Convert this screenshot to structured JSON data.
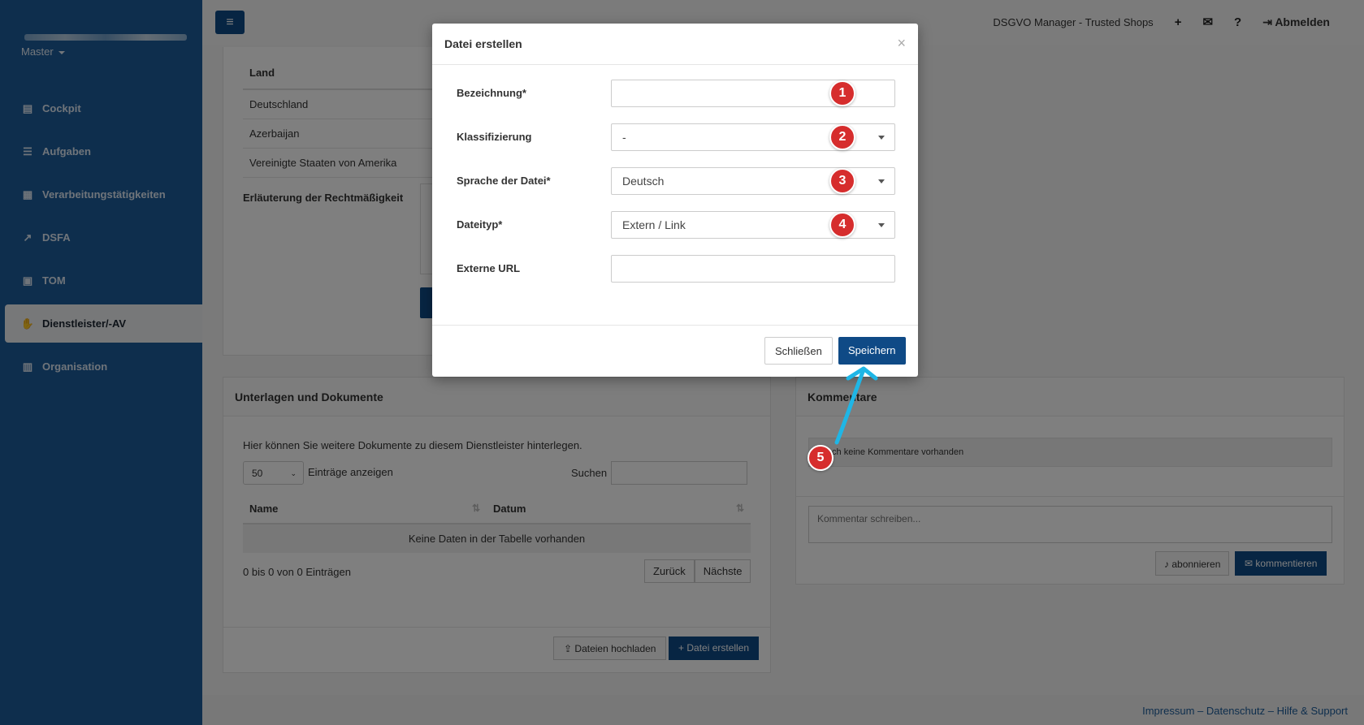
{
  "sidebar": {
    "master_label": "Master",
    "items": [
      {
        "label": "Cockpit",
        "icon": "chart-icon"
      },
      {
        "label": "Aufgaben",
        "icon": "list-icon"
      },
      {
        "label": "Verarbeitungstätigkeiten",
        "icon": "table-icon"
      },
      {
        "label": "DSFA",
        "icon": "line-chart-icon"
      },
      {
        "label": "TOM",
        "icon": "lock-icon"
      },
      {
        "label": "Dienstleister/-AV",
        "icon": "handshake-icon"
      },
      {
        "label": "Organisation",
        "icon": "building-icon"
      }
    ],
    "active_index": 5
  },
  "topbar": {
    "app_name": "DSGVO Manager - Trusted Shops",
    "logout_label": "Abmelden"
  },
  "country_table": {
    "header": "Land",
    "rows": [
      "Deutschland",
      "Azerbaijan",
      "Vereinigte Staaten von Amerika"
    ],
    "legality_label": "Erläuterung der Rechtmäßigkeit"
  },
  "documents": {
    "title": "Unterlagen und Dokumente",
    "intro": "Hier können Sie weitere Dokumente zu diesem Dienstleister hinterlegen.",
    "page_size": "50",
    "entries_label": "Einträge anzeigen",
    "search_label": "Suchen",
    "columns": [
      "Name",
      "Datum"
    ],
    "empty_text": "Keine Daten in der Tabelle vorhanden",
    "info": "0 bis 0 von 0 Einträgen",
    "prev_label": "Zurück",
    "next_label": "Nächste",
    "upload_label": "Dateien hochladen",
    "create_label": "Datei erstellen"
  },
  "comments": {
    "title": "Kommentare",
    "empty": "Noch keine Kommentare vorhanden",
    "placeholder": "Kommentar schreiben...",
    "subscribe_label": "abonnieren",
    "comment_label": "kommentieren"
  },
  "footer": {
    "links": "Impressum – Datenschutz – Hilfe & Support"
  },
  "modal": {
    "title": "Datei erstellen",
    "fields": [
      {
        "label": "Bezeichnung*",
        "value": "",
        "type": "text"
      },
      {
        "label": "Klassifizierung",
        "value": "-",
        "type": "select"
      },
      {
        "label": "Sprache der Datei*",
        "value": "Deutsch",
        "type": "select"
      },
      {
        "label": "Dateityp*",
        "value": "Extern / Link",
        "type": "select"
      },
      {
        "label": "Externe URL",
        "value": "",
        "type": "text"
      }
    ],
    "close_label": "Schließen",
    "save_label": "Speichern"
  },
  "markers": [
    "1",
    "2",
    "3",
    "4",
    "5"
  ],
  "colors": {
    "sidebar": "#1d5d9b",
    "primary": "#0f4a86",
    "marker": "#d62d2d",
    "arrow": "#1fb6e6"
  }
}
